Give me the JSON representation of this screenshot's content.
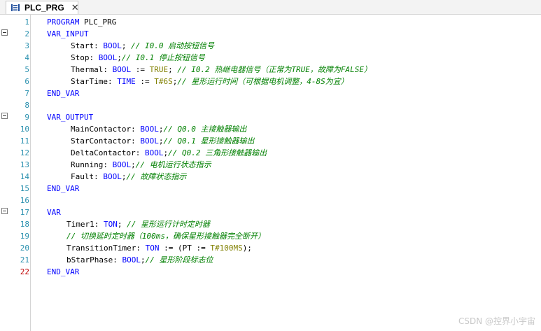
{
  "tab": {
    "title": "PLC_PRG",
    "icon": "pou-program-icon",
    "close_symbol": "✕"
  },
  "line_numbers": [
    "1",
    "2",
    "3",
    "4",
    "5",
    "6",
    "7",
    "8",
    "9",
    "10",
    "11",
    "12",
    "13",
    "14",
    "15",
    "16",
    "17",
    "18",
    "19",
    "20",
    "21",
    "22"
  ],
  "current_line": "22",
  "code": {
    "l1": {
      "kw": "PROGRAM",
      "rest": " PLC_PRG"
    },
    "l2": {
      "kw": "VAR_INPUT"
    },
    "l3": {
      "name": "Start: ",
      "type": "BOOL",
      "sep": "; ",
      "comment": "// I0.0 启动按钮信号"
    },
    "l4": {
      "name": "Stop: ",
      "type": "BOOL",
      "sep": ";",
      "comment": "// I0.1 停止按钮信号"
    },
    "l5": {
      "name": "Thermal: ",
      "type": "BOOL",
      "op": " := ",
      "val": "TRUE",
      "sep": "; ",
      "comment": "// I0.2 热继电器信号（正常为TRUE，故障为FALSE）"
    },
    "l6": {
      "name": "StarTime: ",
      "type": "TIME",
      "op": " := ",
      "val": "T#6S",
      "sep": ";",
      "comment": "// 星形运行时间（可根据电机调整，4-8S为宜）"
    },
    "l7": {
      "kw": "END_VAR"
    },
    "l9": {
      "kw": "VAR_OUTPUT"
    },
    "l10": {
      "name": "MainContactor: ",
      "type": "BOOL",
      "sep": ";",
      "comment": "// Q0.0 主接触器输出"
    },
    "l11": {
      "name": "StarContactor: ",
      "type": "BOOL",
      "sep": ";",
      "comment": "// Q0.1 星形接触器输出"
    },
    "l12": {
      "name": "DeltaContactor: ",
      "type": "BOOL",
      "sep": ";",
      "comment": "// Q0.2 三角形接触器输出"
    },
    "l13": {
      "name": "Running: ",
      "type": "BOOL",
      "sep": ";",
      "comment": "// 电机运行状态指示"
    },
    "l14": {
      "name": "Fault: ",
      "type": "BOOL",
      "sep": ";",
      "comment": "// 故障状态指示"
    },
    "l15": {
      "kw": "END_VAR"
    },
    "l17": {
      "kw": "VAR"
    },
    "l18": {
      "name": "Timer1: ",
      "type": "TON",
      "sep": "; ",
      "comment": "// 星形运行计时定时器"
    },
    "l19": {
      "comment": "// 切换延时定时器（100ms，确保星形接触器完全断开）"
    },
    "l20": {
      "name": "TransitionTimer: ",
      "type": "TON",
      "op": " := (PT := ",
      "val": "T#100MS",
      "sep": ");"
    },
    "l21": {
      "name": "bStarPhase: ",
      "type": "BOOL",
      "sep": ";",
      "comment": "// 星形阶段标志位"
    },
    "l22": {
      "kw": "END_VAR"
    }
  },
  "watermark": "CSDN @控界小宇宙"
}
